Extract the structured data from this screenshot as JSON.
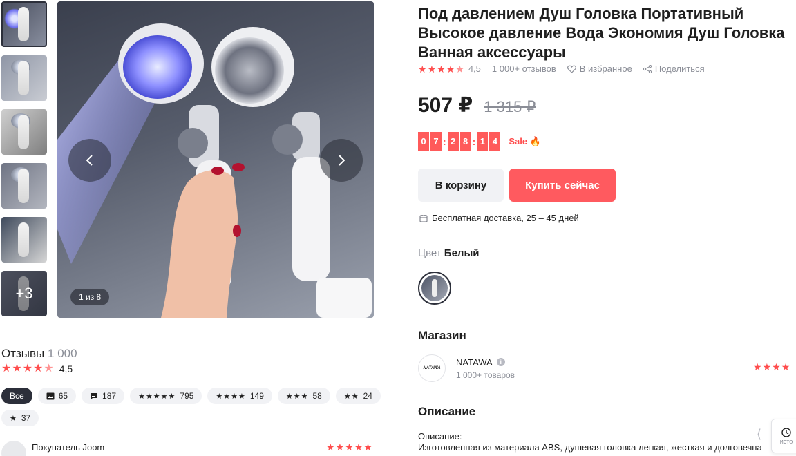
{
  "gallery": {
    "counter": "1 из 8",
    "more_label": "+3"
  },
  "product": {
    "title": "Под давлением Душ Головка Портативный Высокое давление Вода Экономия Душ Головка Ванная аксессуары",
    "rating": "4,5",
    "reviews_count": "1 000+ отзывов",
    "favorite_label": "В избранное",
    "share_label": "Поделиться",
    "price": "507 ₽",
    "old_price": "1 315 ₽",
    "timer_digits": [
      "0",
      "7",
      "2",
      "8",
      "1",
      "4"
    ],
    "sale_label": "Sale 🔥",
    "cart_button": "В корзину",
    "buy_button": "Купить сейчас",
    "delivery": "Бесплатная доставка, 25 – 45 дней",
    "color_label": "Цвет",
    "color_value": "Белый"
  },
  "shop": {
    "heading": "Магазин",
    "logo_text": "NATAWA",
    "name": "NATAWA",
    "products": "1 000+ товаров"
  },
  "description": {
    "heading": "Описание",
    "line1": "Описание:",
    "line2": "Изготовленная из материала ABS, душевая головка легкая, жесткая и долговечна"
  },
  "history_label": "исто",
  "reviews": {
    "title": "Отзывы",
    "count": "1 000",
    "rating": "4,5",
    "chips": [
      {
        "label": "Все"
      },
      {
        "label": "65"
      },
      {
        "label": "187"
      },
      {
        "label": "795"
      },
      {
        "label": "149"
      },
      {
        "label": "58"
      },
      {
        "label": "24"
      },
      {
        "label": "37"
      }
    ],
    "first_reviewer": "Покупатель Joom"
  },
  "colors": {
    "accent": "#ff5a5f",
    "star": "#ff4d4d"
  }
}
